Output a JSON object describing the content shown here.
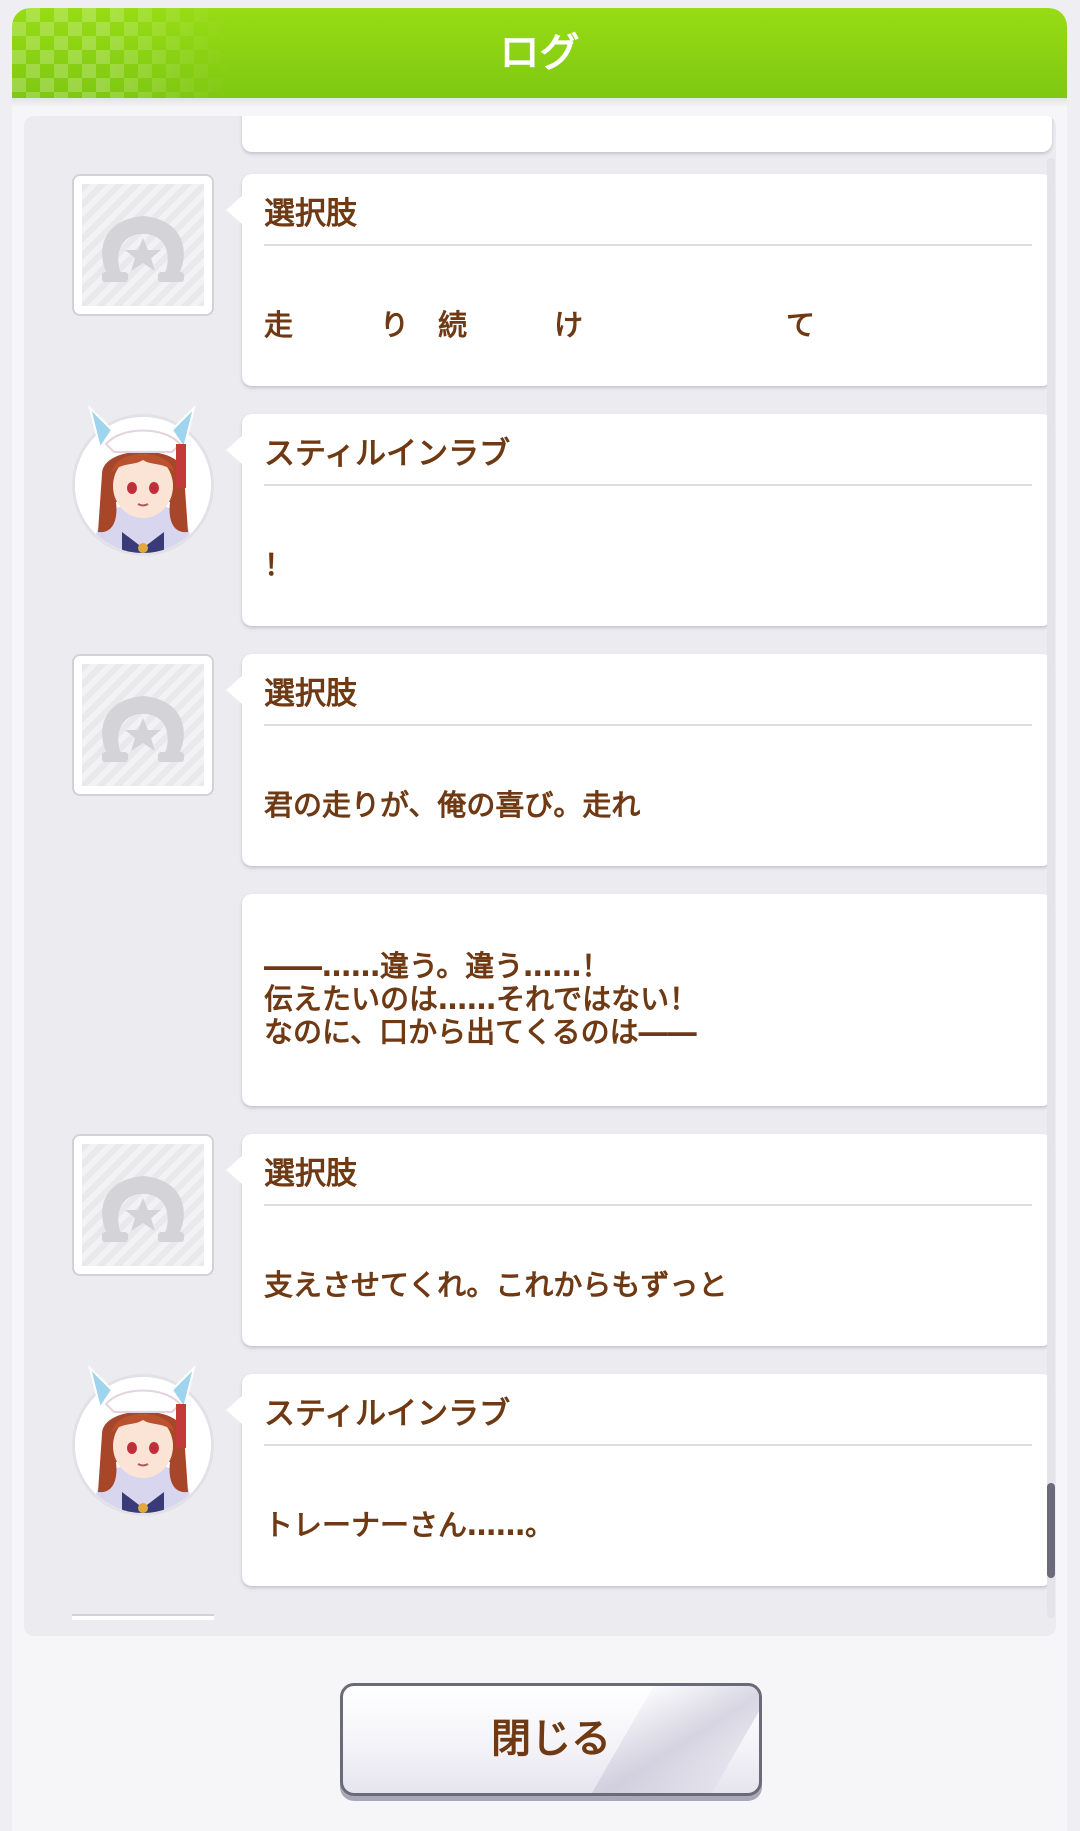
{
  "header": {
    "title": "ログ"
  },
  "log_entries": [
    {
      "type": "continuation",
      "text": ""
    },
    {
      "type": "choice",
      "speaker": "選択肢",
      "text": "走　　　り　続　　　け　　　　　　　て",
      "icon": "horseshoe-star-icon"
    },
    {
      "type": "character",
      "speaker": "スティルインラブ",
      "text": "！",
      "icon": "character-portrait-still-in-love"
    },
    {
      "type": "choice",
      "speaker": "選択肢",
      "text": "君の走りが、俺の喜び。走れ",
      "icon": "horseshoe-star-icon"
    },
    {
      "type": "narration",
      "lines": [
        "――……違う。違う……！",
        "伝えたいのは……それではない！",
        "なのに、口から出てくるのは――"
      ]
    },
    {
      "type": "choice",
      "speaker": "選択肢",
      "text": "支えさせてくれ。これからもずっと",
      "icon": "horseshoe-star-icon"
    },
    {
      "type": "character",
      "speaker": "スティルインラブ",
      "text": "トレーナーさん……。",
      "icon": "character-portrait-still-in-love"
    }
  ],
  "footer": {
    "close_label": "閉じる"
  },
  "colors": {
    "header_green": "#8ed414",
    "text_brown": "#6f3a13",
    "background": "#efeef3",
    "bubble": "#ffffff"
  }
}
